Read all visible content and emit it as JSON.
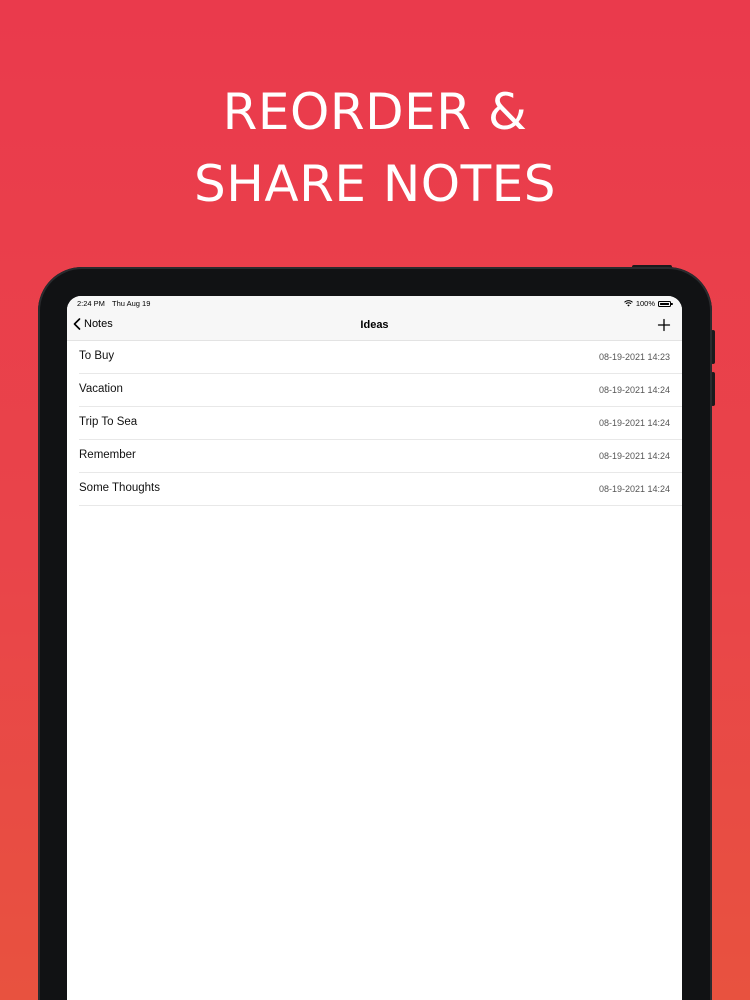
{
  "headline": {
    "line1": "REORDER &",
    "line2": "SHARE NOTES"
  },
  "status_bar": {
    "time": "2:24 PM",
    "date": "Thu Aug 19",
    "battery": "100%",
    "wifi_icon": "wifi-icon",
    "battery_icon": "battery-icon"
  },
  "nav": {
    "back_label": "Notes",
    "back_icon": "chevron-left-icon",
    "title": "Ideas",
    "add_icon": "plus-icon"
  },
  "notes": [
    {
      "title": "To Buy",
      "date": "08-19-2021 14:23"
    },
    {
      "title": "Vacation",
      "date": "08-19-2021 14:24"
    },
    {
      "title": "Trip To Sea",
      "date": "08-19-2021 14:24"
    },
    {
      "title": "Remember",
      "date": "08-19-2021 14:24"
    },
    {
      "title": "Some Thoughts",
      "date": "08-19-2021 14:24"
    }
  ],
  "colors": {
    "background_top": "#ea3a4c",
    "background_bottom": "#e8523f",
    "headline_text": "#ffffff"
  }
}
